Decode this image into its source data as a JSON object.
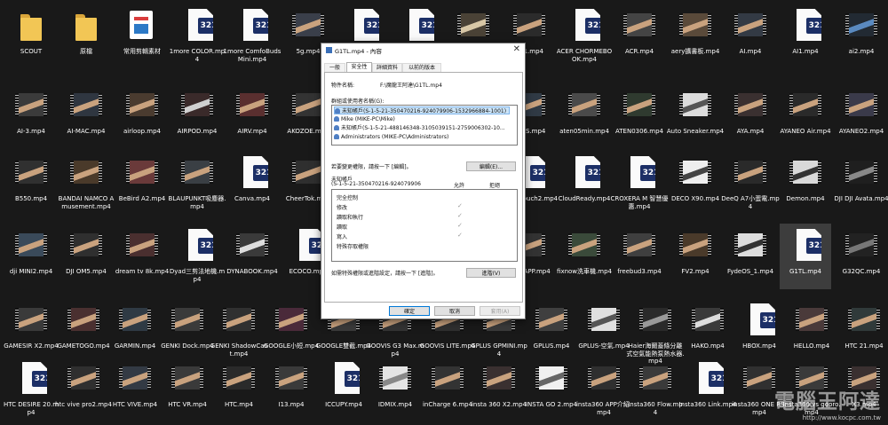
{
  "desktop": {
    "tiles": [
      {
        "label": "SCOUT",
        "kind": "folder",
        "c1": "#f2c655",
        "c2": "#d9a53a"
      },
      {
        "label": "原檔",
        "kind": "folder",
        "c1": "#f2c655",
        "c2": "#d9a53a"
      },
      {
        "label": "常用剪輯素材",
        "kind": "app",
        "c1": "#ffffff",
        "c2": "#2c79c6"
      },
      {
        "label": "1more COLOR.mp4",
        "kind": "doc",
        "c1": "#fafafa",
        "c2": "#1c2f66"
      },
      {
        "label": "1more ComfoBuds Mini.mp4",
        "kind": "doc",
        "c1": "#fafafa",
        "c2": "#1c2f66"
      },
      {
        "label": "5g.mp4",
        "kind": "video",
        "c1": "#3a3f4a",
        "c2": "#c9a27e"
      },
      {
        "label": "",
        "kind": "doc",
        "c1": "#fafafa",
        "c2": "#1c2f66"
      },
      {
        "label": "",
        "kind": "doc",
        "c1": "#fafafa",
        "c2": "#1c2f66"
      },
      {
        "label": "",
        "kind": "video",
        "c1": "#4a4236",
        "c2": "#d8c7a6"
      },
      {
        "label": "AB1.mp4",
        "kind": "video",
        "c1": "#2b2b2b",
        "c2": "#c9a27e"
      },
      {
        "label": "ACER CHORMEBOOK.mp4",
        "kind": "doc",
        "c1": "#fafafa",
        "c2": "#1c2f66"
      },
      {
        "label": "ACR.mp4",
        "kind": "video",
        "c1": "#444444",
        "c2": "#c9a27e"
      },
      {
        "label": "aery擴書板.mp4",
        "kind": "video",
        "c1": "#5a4a3a",
        "c2": "#c9a27e"
      },
      {
        "label": "AI.mp4",
        "kind": "video",
        "c1": "#333a44",
        "c2": "#c9a27e"
      },
      {
        "label": "AI1.mp4",
        "kind": "doc",
        "c1": "#fafafa",
        "c2": "#1c2f66"
      },
      {
        "label": "ai2.mp4",
        "kind": "video",
        "c1": "#222a33",
        "c2": "#5a8ac0"
      },
      {
        "label": "AI-3.mp4",
        "kind": "video",
        "c1": "#3b3b3b",
        "c2": "#c9a27e"
      },
      {
        "label": "AI-MAC.mp4",
        "kind": "video",
        "c1": "#2f3640",
        "c2": "#c9a27e"
      },
      {
        "label": "airloop.mp4",
        "kind": "video",
        "c1": "#4a3b2f",
        "c2": "#c9a27e"
      },
      {
        "label": "AIRPOD.mp4",
        "kind": "video",
        "c1": "#3a2a2a",
        "c2": "#d0d0d0"
      },
      {
        "label": "AIRV.mp4",
        "kind": "video",
        "c1": "#5a2f2f",
        "c2": "#c9a27e"
      },
      {
        "label": "AKOZOE.mp4",
        "kind": "video",
        "c1": "#333333",
        "c2": "#c9a27e"
      },
      {
        "label": "",
        "kind": "video",
        "c1": "#3a3a3a",
        "c2": "#c9a27e"
      },
      {
        "label": "",
        "kind": "video",
        "c1": "#3a3a3a",
        "c2": "#c9a27e"
      },
      {
        "label": "",
        "kind": "video",
        "c1": "#3a3a3a",
        "c2": "#c9a27e"
      },
      {
        "label": "ASUS.mp4",
        "kind": "video",
        "c1": "#303a45",
        "c2": "#c9a27e"
      },
      {
        "label": "aten05min.mp4",
        "kind": "video",
        "c1": "#4a4a4a",
        "c2": "#c9a27e"
      },
      {
        "label": "ATEN0306.mp4",
        "kind": "video",
        "c1": "#2f3a2f",
        "c2": "#c9a27e"
      },
      {
        "label": "Auto Sneaker.mp4",
        "kind": "video",
        "c1": "#dcdcdc",
        "c2": "#555555"
      },
      {
        "label": "AYA.mp4",
        "kind": "video",
        "c1": "#3a3030",
        "c2": "#c9a27e"
      },
      {
        "label": "AYANEO Air.mp4",
        "kind": "video",
        "c1": "#2a2a2a",
        "c2": "#c9a27e"
      },
      {
        "label": "AYANEO2.mp4",
        "kind": "video",
        "c1": "#3a3a4a",
        "c2": "#c9a27e"
      },
      {
        "label": "B550.mp4",
        "kind": "video",
        "c1": "#303030",
        "c2": "#c9a27e"
      },
      {
        "label": "BANDAI NAMCO Amusement.mp4",
        "kind": "video",
        "c1": "#4a3a2a",
        "c2": "#c9a27e"
      },
      {
        "label": "BeBird A2.mp4",
        "kind": "video",
        "c1": "#6a3a3a",
        "c2": "#c9a27e"
      },
      {
        "label": "BLAUPUNKT吸塵器.mp4",
        "kind": "video",
        "c1": "#3a3f44",
        "c2": "#c9a27e"
      },
      {
        "label": "Canva.mp4",
        "kind": "doc",
        "c1": "#fafafa",
        "c2": "#1c2f66"
      },
      {
        "label": "CheerTok.mp4",
        "kind": "video",
        "c1": "#2f2f2f",
        "c2": "#c9a27e"
      },
      {
        "label": "",
        "kind": "video",
        "c1": "#3a3a3a",
        "c2": "#c9a27e"
      },
      {
        "label": "",
        "kind": "video",
        "c1": "#3a3a3a",
        "c2": "#c9a27e"
      },
      {
        "label": "",
        "kind": "video",
        "c1": "#3a3a3a",
        "c2": "#c9a27e"
      },
      {
        "label": "Click&touch2.mp4",
        "kind": "doc",
        "c1": "#fafafa",
        "c2": "#1c2f66"
      },
      {
        "label": "CloudReady.mp4",
        "kind": "doc",
        "c1": "#fafafa",
        "c2": "#1c2f66"
      },
      {
        "label": "CROXERA M 智慧優惠.mp4",
        "kind": "doc",
        "c1": "#fafafa",
        "c2": "#1c2f66"
      },
      {
        "label": "DECO X90.mp4",
        "kind": "video",
        "c1": "#eeeeee",
        "c2": "#444444"
      },
      {
        "label": "DeeQ A7小蛋電.mp4",
        "kind": "video",
        "c1": "#2a2a2a",
        "c2": "#c9a27e"
      },
      {
        "label": "Demon.mp4",
        "kind": "video",
        "c1": "#d9d9d9",
        "c2": "#333333"
      },
      {
        "label": "DJI DJI Avata.mp4",
        "kind": "video",
        "c1": "#1f1f1f",
        "c2": "#888888"
      },
      {
        "label": "dji MINI2.mp4",
        "kind": "video",
        "c1": "#3a4a5a",
        "c2": "#c9a27e"
      },
      {
        "label": "DJI OM5.mp4",
        "kind": "video",
        "c1": "#2f2f2f",
        "c2": "#c9a27e"
      },
      {
        "label": "dream tv 8k.mp4",
        "kind": "video",
        "c1": "#4a2f2f",
        "c2": "#c9a27e"
      },
      {
        "label": "Dyad三剪法地機.mp4",
        "kind": "doc",
        "c1": "#fafafa",
        "c2": "#1c2f66"
      },
      {
        "label": "DYNABOOK.mp4",
        "kind": "video",
        "c1": "#3a3a3a",
        "c2": "#dddddd"
      },
      {
        "label": "ECOCO.mp4",
        "kind": "doc",
        "c1": "#fafafa",
        "c2": "#1c2f66"
      },
      {
        "label": "",
        "kind": "video",
        "c1": "#3a3a3a",
        "c2": "#c9a27e"
      },
      {
        "label": "",
        "kind": "video",
        "c1": "#3a3a3a",
        "c2": "#c9a27e"
      },
      {
        "label": "",
        "kind": "video",
        "c1": "#3a3a3a",
        "c2": "#c9a27e"
      },
      {
        "label": "FACEAPP.mp4",
        "kind": "video",
        "c1": "#333333",
        "c2": "#c9a27e"
      },
      {
        "label": "fixnow洗車機.mp4",
        "kind": "video",
        "c1": "#3a4a3a",
        "c2": "#c9a27e"
      },
      {
        "label": "freebud3.mp4",
        "kind": "video",
        "c1": "#3f3f3f",
        "c2": "#c9a27e"
      },
      {
        "label": "FV2.mp4",
        "kind": "video",
        "c1": "#4a3a2a",
        "c2": "#c9a27e"
      },
      {
        "label": "FydeOS_1.mp4",
        "kind": "video",
        "c1": "#dddddd",
        "c2": "#333333"
      },
      {
        "label": "G1TL.mp4",
        "kind": "doc",
        "c1": "#fafafa",
        "c2": "#1c2f66",
        "selected": true
      },
      {
        "label": "G32QC.mp4",
        "kind": "video",
        "c1": "#222222",
        "c2": "#777777"
      },
      {
        "label": "GAMESIR X2.mp4",
        "kind": "video",
        "c1": "#3a3a3a",
        "c2": "#c9a27e"
      },
      {
        "label": "GAMETOGO.mp4",
        "kind": "video",
        "c1": "#4a3030",
        "c2": "#c9a27e"
      },
      {
        "label": "GARMIN.mp4",
        "kind": "video",
        "c1": "#2f3a44",
        "c2": "#c9a27e"
      },
      {
        "label": "GENKI Dock.mp4",
        "kind": "video",
        "c1": "#3a3a3a",
        "c2": "#c9a27e"
      },
      {
        "label": "GENKI ShadowCast.mp4",
        "kind": "video",
        "c1": "#303030",
        "c2": "#c9a27e"
      },
      {
        "label": "GOOGLE小短.mp4",
        "kind": "video",
        "c1": "#4a2a3a",
        "c2": "#c9a27e"
      },
      {
        "label": "GOOGLE雙截.mp4",
        "kind": "video",
        "c1": "#3a3a3a",
        "c2": "#c9a27e"
      },
      {
        "label": "GOOVIS G3 Max.mp4",
        "kind": "video",
        "c1": "#333333",
        "c2": "#c9a27e"
      },
      {
        "label": "GOOVIS LITE.mp4",
        "kind": "video",
        "c1": "#2f2f2f",
        "c2": "#c9a27e"
      },
      {
        "label": "GPLUS GPMINI.mp4",
        "kind": "video",
        "c1": "#3a3a3a",
        "c2": "#c9a27e"
      },
      {
        "label": "GPLUS.mp4",
        "kind": "video",
        "c1": "#3f3f3f",
        "c2": "#c9a27e"
      },
      {
        "label": "GPLUS-空氣.mp4",
        "kind": "video",
        "c1": "#e0e0e0",
        "c2": "#555555"
      },
      {
        "label": "Haier海爾蓋條分離式空氣能熱泵熱水器.mp4",
        "kind": "video",
        "c1": "#2a2a2a",
        "c2": "#999999"
      },
      {
        "label": "HAKO.mp4",
        "kind": "video",
        "c1": "#3a3a3a",
        "c2": "#dddddd"
      },
      {
        "label": "HBOX.mp4",
        "kind": "doc",
        "c1": "#fafafa",
        "c2": "#1c2f66"
      },
      {
        "label": "HELLO.mp4",
        "kind": "video",
        "c1": "#4a3a3a",
        "c2": "#c9a27e"
      },
      {
        "label": "HTC 21.mp4",
        "kind": "video",
        "c1": "#303a3a",
        "c2": "#c9a27e"
      },
      {
        "label": "HTC DESIRE 20.mp4",
        "kind": "doc",
        "c1": "#fafafa",
        "c2": "#1c2f66"
      },
      {
        "label": "htc vive pro2.mp4",
        "kind": "video",
        "c1": "#2f2f2f",
        "c2": "#c9a27e"
      },
      {
        "label": "HTC VIVE.mp4",
        "kind": "video",
        "c1": "#333a44",
        "c2": "#c9a27e"
      },
      {
        "label": "HTC VR.mp4",
        "kind": "video",
        "c1": "#3a3a3a",
        "c2": "#c9a27e"
      },
      {
        "label": "HTC.mp4",
        "kind": "video",
        "c1": "#2a2a2a",
        "c2": "#c9a27e"
      },
      {
        "label": "I13.mp4",
        "kind": "video",
        "c1": "#3a3a3a",
        "c2": "#c9a27e"
      },
      {
        "label": "ICCUPY.mp4",
        "kind": "doc",
        "c1": "#fafafa",
        "c2": "#1c2f66"
      },
      {
        "label": "IDMIX.mp4",
        "kind": "video",
        "c1": "#e4e4e4",
        "c2": "#888888"
      },
      {
        "label": "inCharge 6.mp4",
        "kind": "video",
        "c1": "#333333",
        "c2": "#c9a27e"
      },
      {
        "label": "insta 360 X2.mp4",
        "kind": "video",
        "c1": "#3a3030",
        "c2": "#c9a27e"
      },
      {
        "label": "INSTA GO 2.mp4",
        "kind": "video",
        "c1": "#f0f0f0",
        "c2": "#666666"
      },
      {
        "label": "insta360 APP介紹.mp4",
        "kind": "video",
        "c1": "#2f2f2f",
        "c2": "#c9a27e"
      },
      {
        "label": "Insta360 Flow.mp4",
        "kind": "video",
        "c1": "#3a3a3a",
        "c2": "#c9a27e"
      },
      {
        "label": "Insta360 Link.mp4",
        "kind": "doc",
        "c1": "#fafafa",
        "c2": "#1c2f66"
      },
      {
        "label": "insta360 ONE RS.mp4",
        "kind": "video",
        "c1": "#303030",
        "c2": "#c9a27e"
      },
      {
        "label": "Insta360 vs gopro.mp4",
        "kind": "video",
        "c1": "#3a3a3a",
        "c2": "#c9a27e"
      },
      {
        "label": "X3.mp4",
        "kind": "video",
        "c1": "#3a3030",
        "c2": "#c9a27e"
      }
    ]
  },
  "dialog": {
    "title": "G1TL.mp4 - 內容",
    "close_icon": "close-icon",
    "tabs": [
      "一般",
      "安全性",
      "詳細資料",
      "以前的版本"
    ],
    "active_tab": 1,
    "object_name_label": "物件名稱:",
    "object_name_value": "F:\\魔龍王阿達\\G1TL.mp4",
    "groups_label": "群組或使用者名稱(G):",
    "users": [
      "未知帳戶(S-1-5-21-350470216-924079906-1532966884-1001)",
      "Mike (MIKE-PC\\Mike)",
      "未知帳戶(S-1-5-21-488146348-3105039151-2759006302-10...",
      "Administrators (MIKE-PC\\Administrators)"
    ],
    "selected_user": 0,
    "edit_hint": "若要變更權限，請按一下 [編輯]。",
    "edit_button": "編輯(E)...",
    "perm_label_line1": "未知帳戶",
    "perm_label_line2": "(S-1-5-21-350470216-924079906",
    "allow_header": "允許",
    "deny_header": "拒絕",
    "permissions": [
      "完全控制",
      "修改",
      "讀取和執行",
      "讀取",
      "寫入",
      "特殊存取權限"
    ],
    "allowed": [
      false,
      true,
      true,
      true,
      true,
      false
    ],
    "check_glyph": "✓",
    "advanced_hint": "如需特殊權限或進階設定，請按一下 [進階]。",
    "advanced_button": "進階(V)",
    "ok_button": "確定",
    "cancel_button": "取消",
    "apply_button": "套用(A)"
  },
  "watermark": {
    "title": "電腦王阿達",
    "url": "http://www.kocpc.com.tw"
  }
}
